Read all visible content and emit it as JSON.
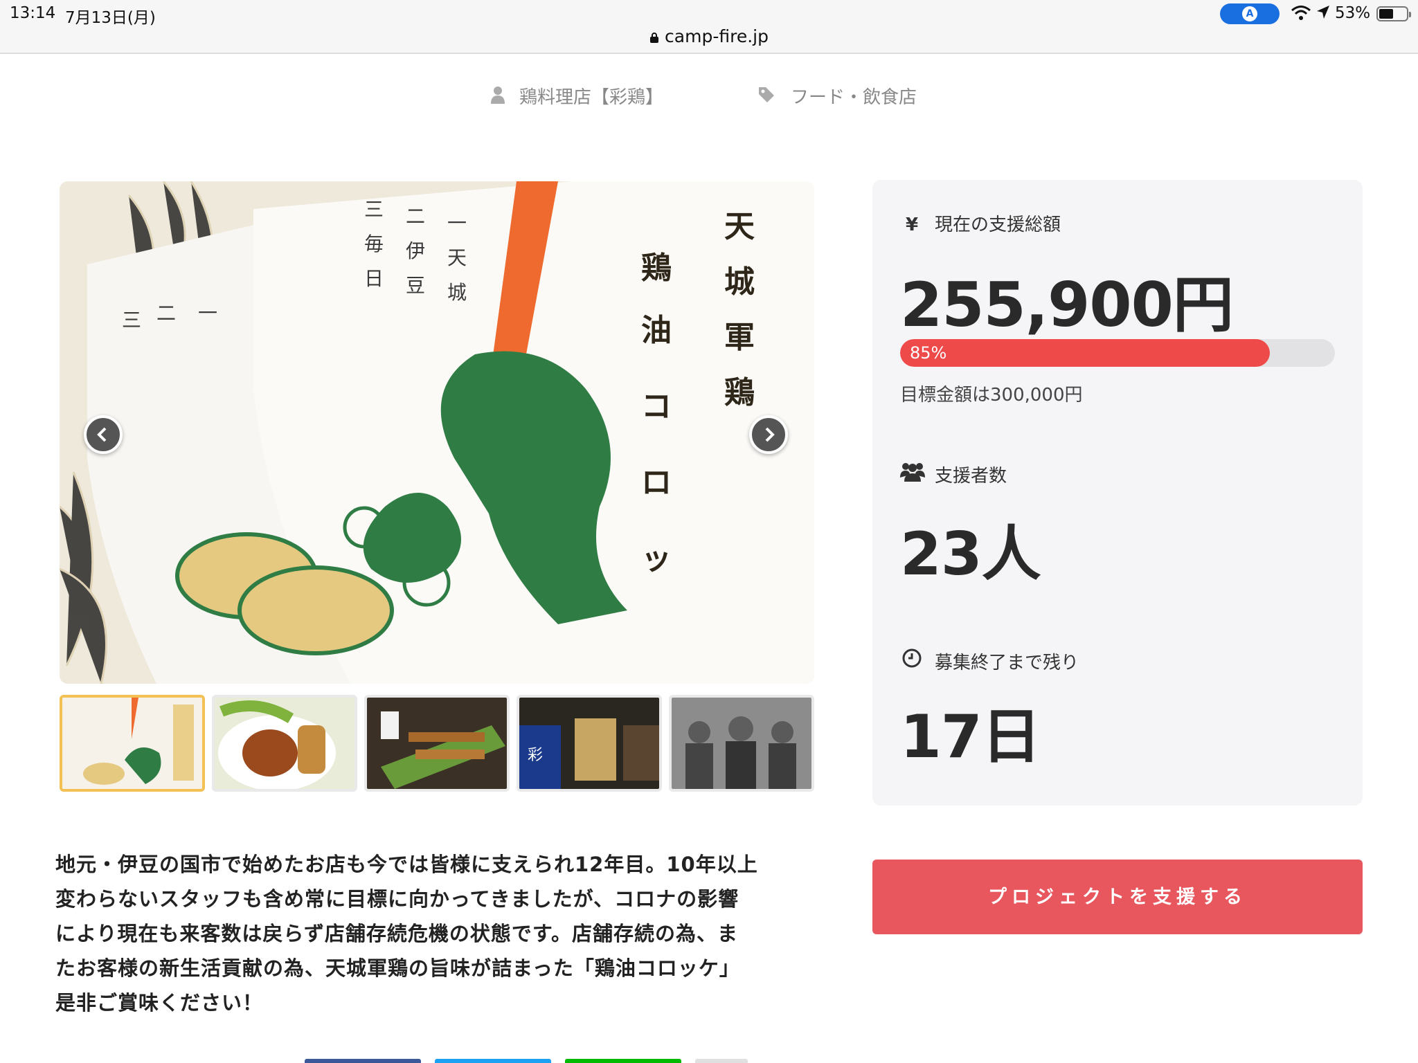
{
  "status_bar": {
    "time": "13:14",
    "date": "7月13日(月)",
    "url": "camp-fire.jp",
    "battery": "53%"
  },
  "meta": {
    "owner": "鶏料理店【彩鶏】",
    "category": "フード・飲食店"
  },
  "stats": {
    "amount_label": "現在の支援総額",
    "amount": "255,900円",
    "progress_percent": 85,
    "progress_label": "85%",
    "goal": "目標金額は300,000円",
    "supporters_label": "支援者数",
    "supporters": "23人",
    "remaining_label": "募集終了まで残り",
    "remaining": "17日"
  },
  "description": [
    "地元・伊豆の国市で始めたお店も今では皆様に支えられ12年目。10年以上",
    "変わらないスタッフも含め常に目標に向かってきましたが、コロナの影響",
    "により現在も来客数は戻らず店舗存続危機の状態です。店舗存続の為、ま",
    "たお客様の新生活貢献の為、天城軍鶏の旨味が詰まった「鶏油コロッケ」",
    "是非ご賞味ください！"
  ],
  "support_button": "プロジェクトを支援する",
  "colors": {
    "accent_red": "#ef4a4a",
    "button_red": "#e8565e",
    "panel_bg": "#f5f5f7",
    "thumb_active": "#f3c054"
  },
  "icons": {
    "yen": "¥"
  }
}
